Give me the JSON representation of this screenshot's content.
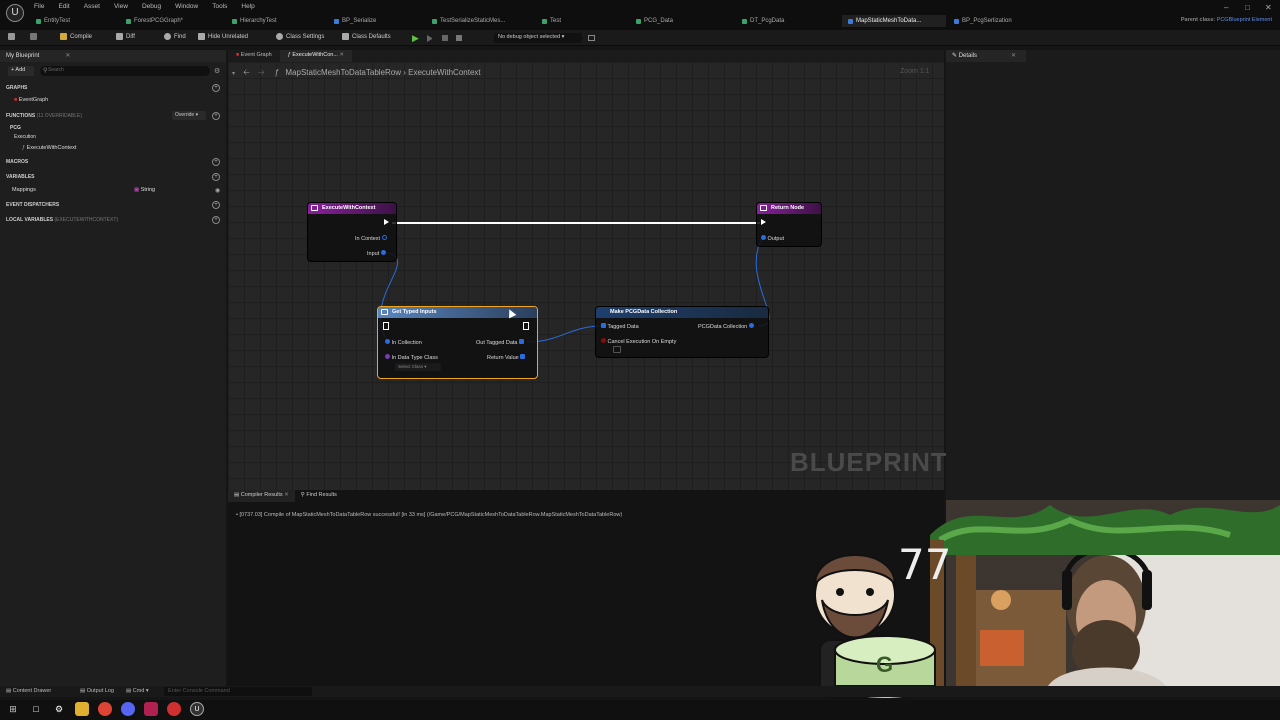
{
  "menu": [
    "File",
    "Edit",
    "Asset",
    "View",
    "Debug",
    "Window",
    "Tools",
    "Help"
  ],
  "doc_tabs": [
    "EntityTest",
    "ForestPCGGraph*",
    "HierarchyTest",
    "BP_Serialize",
    "TestSerializeStaticMes...",
    "Test",
    "PCG_Data",
    "DT_PcgData",
    "MapStaticMeshToData...",
    "BP_PcgSerlization"
  ],
  "parent_class": {
    "label": "Parent class:",
    "value": "PCGBlueprint Element"
  },
  "toolbar": {
    "compile": "Compile",
    "diff": "Diff",
    "find": "Find",
    "hide_unrelated": "Hide Unrelated",
    "class_settings": "Class Settings",
    "class_defaults": "Class Defaults",
    "debug_select": "No debug object selected"
  },
  "left": {
    "title": "My Blueprint",
    "add": "+ Add",
    "search_placeholder": "Search",
    "graphs": "GRAPHS",
    "event_graph": "EventGraph",
    "functions": "FUNCTIONS",
    "functions_sub": "(11 OVERRIDABLE)",
    "override": "Override",
    "pcg": "PCG",
    "execution": "Execution",
    "execute_with_context": "ExecuteWithContext",
    "macros": "MACROS",
    "variables": "VARIABLES",
    "mappings": "Mappings",
    "mappings_type": "String",
    "event_dispatchers": "EVENT DISPATCHERS",
    "local_variables": "LOCAL VARIABLES",
    "local_sub": "(EXECUTEWITHCONTEXT)"
  },
  "graph": {
    "tab1": "Event Graph",
    "tab2": "ExecuteWithCon...",
    "crumb_class": "MapStaticMeshToDataTableRow",
    "crumb_func": "ExecuteWithContext",
    "zoom": "Zoom 1:1",
    "watermark": "BLUEPRINT"
  },
  "nodes": {
    "entry": {
      "title": "ExecuteWithContext",
      "pin1": "In Context",
      "pin2": "Input"
    },
    "ret": {
      "title": "Return Node",
      "pin1": "Output"
    },
    "typed": {
      "title": "Get Typed Inputs",
      "in1": "In Collection",
      "in2": "In Data Type Class",
      "select": "Select Class",
      "out1": "Out Tagged Data",
      "out2": "Return Value"
    },
    "make": {
      "title": "Make PCGData Collection",
      "in1": "Tagged Data",
      "in2": "Cancel Execution On Empty",
      "out1": "PCGData Collection"
    }
  },
  "details": {
    "title": "Details"
  },
  "bottom": {
    "tab1": "Compiler Results",
    "tab2": "Find Results",
    "log": "[0737.03] Compile of MapStaticMeshToDataTableRow successful! [in 33 ms] (/Game/PCG/MapStaticMeshToDataTableRow.MapStaticMeshToDataTableRow)"
  },
  "status": {
    "content_drawer": "Content Drawer",
    "output_log": "Output Log",
    "cmd": "Cmd",
    "console_placeholder": "Enter Console Command"
  },
  "overlay": {
    "count": "77",
    "cake_letter": "G"
  }
}
